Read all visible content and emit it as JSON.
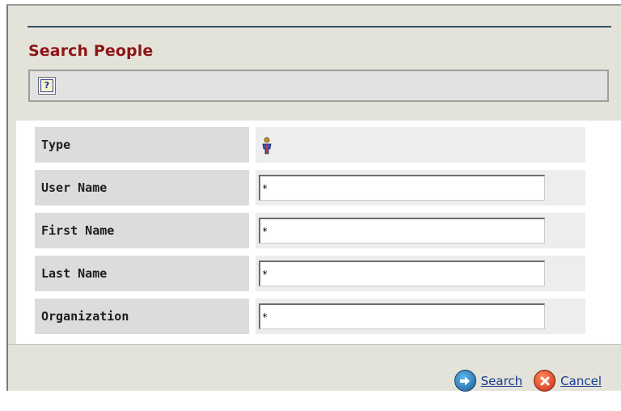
{
  "dialog": {
    "title": "Search People"
  },
  "toolbar": {
    "help_icon": "help-icon",
    "help_glyph": "?"
  },
  "form": {
    "fields": [
      {
        "label": "Type",
        "kind": "icon",
        "icon": "person-icon"
      },
      {
        "label": "User Name",
        "kind": "text",
        "value": "*"
      },
      {
        "label": "First Name",
        "kind": "text",
        "value": "*"
      },
      {
        "label": "Last Name",
        "kind": "text",
        "value": "*"
      },
      {
        "label": "Organization",
        "kind": "text",
        "value": "*"
      }
    ]
  },
  "actions": {
    "search_label": "Search",
    "search_icon": "arrow-right-circle-icon",
    "cancel_label": "Cancel",
    "cancel_icon": "close-circle-icon"
  },
  "colors": {
    "title": "#8e1517",
    "link": "#1a3c8e",
    "background": "#e4e3da"
  }
}
